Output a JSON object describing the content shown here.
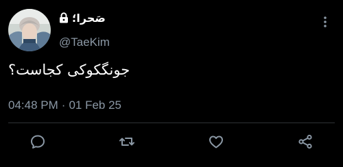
{
  "tweet": {
    "display_name": "صَحرا؛",
    "handle": "@TaeKim",
    "text": "جونگکوکی کجاست؟",
    "time": "04:48 PM",
    "separator": "·",
    "date": "01 Feb 25",
    "locked": true
  },
  "icons": {
    "avatar": "profile-photo",
    "lock": "lock-icon",
    "more": "more-vertical-icon",
    "reply": "reply-icon",
    "retweet": "retweet-icon",
    "like": "heart-icon",
    "share": "share-icon"
  },
  "colors": {
    "background": "#000000",
    "primary_text": "#ffffff",
    "secondary_text": "#8b98a5",
    "divider": "#2f3336",
    "icon": "#8b98a5"
  }
}
